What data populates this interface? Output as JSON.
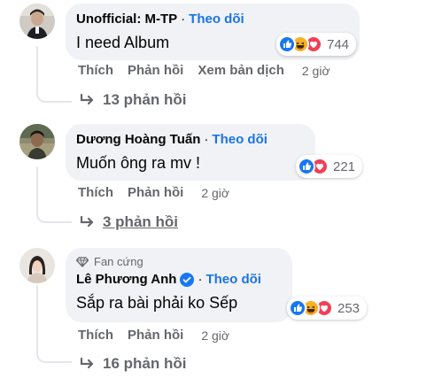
{
  "colors": {
    "link": "#1b74e4",
    "secondary_text": "#65676b",
    "bubble_bg": "#f0f2f5",
    "like_blue": "#1877f2",
    "love_red": "#f33e58",
    "haha_yellow": "#f7b125"
  },
  "comments": [
    {
      "author": "Unofficial: M-TP",
      "separator": "·",
      "follow_label": "Theo dõi",
      "text": "I need Album",
      "reactions": [
        "like-icon",
        "haha-icon",
        "love-icon"
      ],
      "reaction_count": "744",
      "actions": {
        "like": "Thích",
        "reply": "Phản hồi",
        "translate": "Xem bản dịch",
        "time": "2 giờ"
      },
      "replies": "13 phản hồi"
    },
    {
      "author": "Dương Hoàng Tuấn",
      "separator": "·",
      "follow_label": "Theo dõi",
      "text": "Muốn ông ra mv !",
      "reactions": [
        "like-icon",
        "love-icon"
      ],
      "reaction_count": "221",
      "actions": {
        "like": "Thích",
        "reply": "Phản hồi",
        "time": "2 giờ"
      },
      "replies": "3 phản hồi"
    },
    {
      "badge": "Fan cứng",
      "author": "Lê Phương Anh",
      "separator": "·",
      "follow_label": "Theo dõi",
      "text": "Sắp ra bài phải ko Sếp",
      "reactions": [
        "like-icon",
        "haha-icon",
        "love-icon"
      ],
      "reaction_count": "253",
      "actions": {
        "like": "Thích",
        "reply": "Phản hồi",
        "time": "2 giờ"
      },
      "replies": "16 phản hồi"
    }
  ]
}
